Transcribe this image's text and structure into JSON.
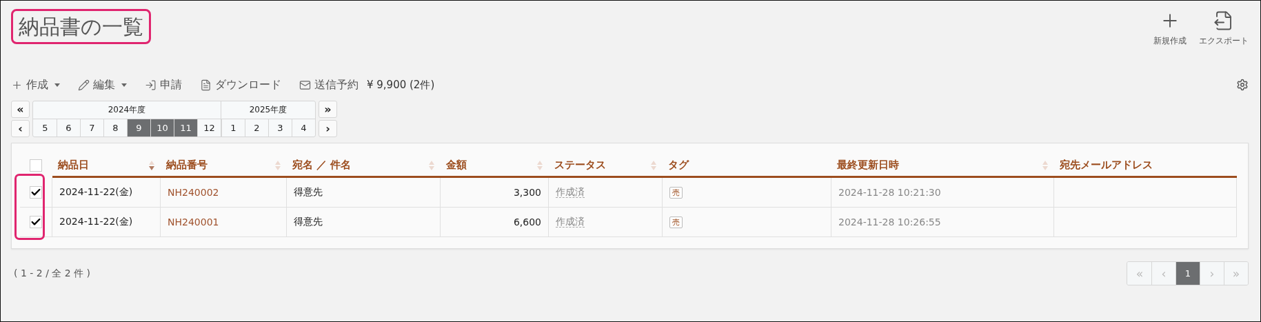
{
  "page_title": {
    "text": "納品書の一覧",
    "highlighted": true
  },
  "header_actions": [
    {
      "kind": "new",
      "label": "新規作成"
    },
    {
      "kind": "export",
      "label": "エクスポート"
    }
  ],
  "toolbar": {
    "items": [
      {
        "kind": "create",
        "label": "作成",
        "dropdown": true
      },
      {
        "kind": "edit",
        "label": "編集",
        "dropdown": true
      },
      {
        "kind": "apply",
        "label": "申請",
        "dropdown": false
      },
      {
        "kind": "pdf",
        "label": "ダウンロード",
        "dropdown": false
      },
      {
        "kind": "mail",
        "label": "送信予約",
        "dropdown": false
      }
    ],
    "total": "¥ 9,900 (2件)"
  },
  "month_picker": {
    "first_button": "«",
    "prev_button": "‹",
    "next_button": "›",
    "last_button": "»",
    "years": [
      {
        "label": "2024年度",
        "months": [
          {
            "label": "5",
            "selected": false
          },
          {
            "label": "6",
            "selected": false
          },
          {
            "label": "7",
            "selected": false
          },
          {
            "label": "8",
            "selected": false
          },
          {
            "label": "9",
            "selected": true
          },
          {
            "label": "10",
            "selected": true
          },
          {
            "label": "11",
            "selected": true
          },
          {
            "label": "12",
            "selected": false
          }
        ]
      },
      {
        "label": "2025年度",
        "months": [
          {
            "label": "1",
            "selected": false
          },
          {
            "label": "2",
            "selected": false
          },
          {
            "label": "3",
            "selected": false
          },
          {
            "label": "4",
            "selected": false
          }
        ]
      }
    ]
  },
  "table": {
    "checkbox_column_highlighted": true,
    "select_all_checked": false,
    "columns": [
      {
        "label": "納品日",
        "sorted": true
      },
      {
        "label": "納品番号",
        "sorted": false
      },
      {
        "label": "宛名 ／ 件名",
        "sorted": false
      },
      {
        "label": "金額",
        "sorted": false
      },
      {
        "label": "ステータス",
        "sorted": false
      },
      {
        "label": "タグ"
      },
      {
        "label": "最終更新日時",
        "sorted": false
      },
      {
        "label": "宛先メールアドレス"
      }
    ],
    "rows": [
      {
        "checked": true,
        "date": "2024-11-22(金)",
        "number": "NH240002",
        "recipient": "得意先",
        "amount": "3,300",
        "status": "作成済",
        "tag": "売",
        "updated": "2024-11-28 10:21:30"
      },
      {
        "checked": true,
        "date": "2024-11-22(金)",
        "number": "NH240001",
        "recipient": "得意先",
        "amount": "6,600",
        "status": "作成済",
        "tag": "売",
        "updated": "2024-11-28 10:26:55"
      }
    ]
  },
  "footer": {
    "count": "( 1 - 2 / 全 2 件 )",
    "pagination": [
      {
        "label": "«",
        "disabled": true,
        "selected": false
      },
      {
        "label": "‹",
        "disabled": true,
        "selected": false
      },
      {
        "label": "1",
        "disabled": false,
        "selected": true
      },
      {
        "label": "›",
        "disabled": true,
        "selected": false
      },
      {
        "label": "»",
        "disabled": true,
        "selected": false
      }
    ]
  }
}
